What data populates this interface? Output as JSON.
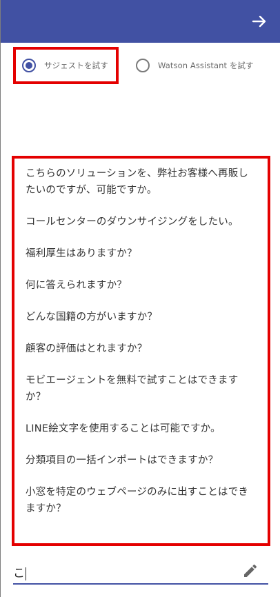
{
  "header": {
    "background": "#4151a3",
    "submit_icon": "arrow-right-icon"
  },
  "radio_group": {
    "options": [
      {
        "label": "サジェストを試す",
        "checked": true
      },
      {
        "label": "Watson Assistant を試す",
        "checked": false
      }
    ]
  },
  "suggestions": [
    "こちらのソリューションを、弊社お客様へ再販したいのですが、可能ですか。",
    "コールセンターのダウンサイジングをしたい。",
    "福利厚生はありますか？",
    "何に答えられますか？",
    "どんな国籍の方がいますか？",
    "顧客の評価はとれますか？",
    "モビエージェントを無料で試すことはできますか？",
    "LINE絵文字を使用することは可能ですか。",
    "分類項目の一括インポートはできますか？",
    "小窓を特定のウェブページのみに出すことはできますか？"
  ],
  "input": {
    "value": "こ",
    "icon": "pencil-icon"
  },
  "colors": {
    "accent": "#4151a3",
    "highlight_border": "#e40000"
  }
}
